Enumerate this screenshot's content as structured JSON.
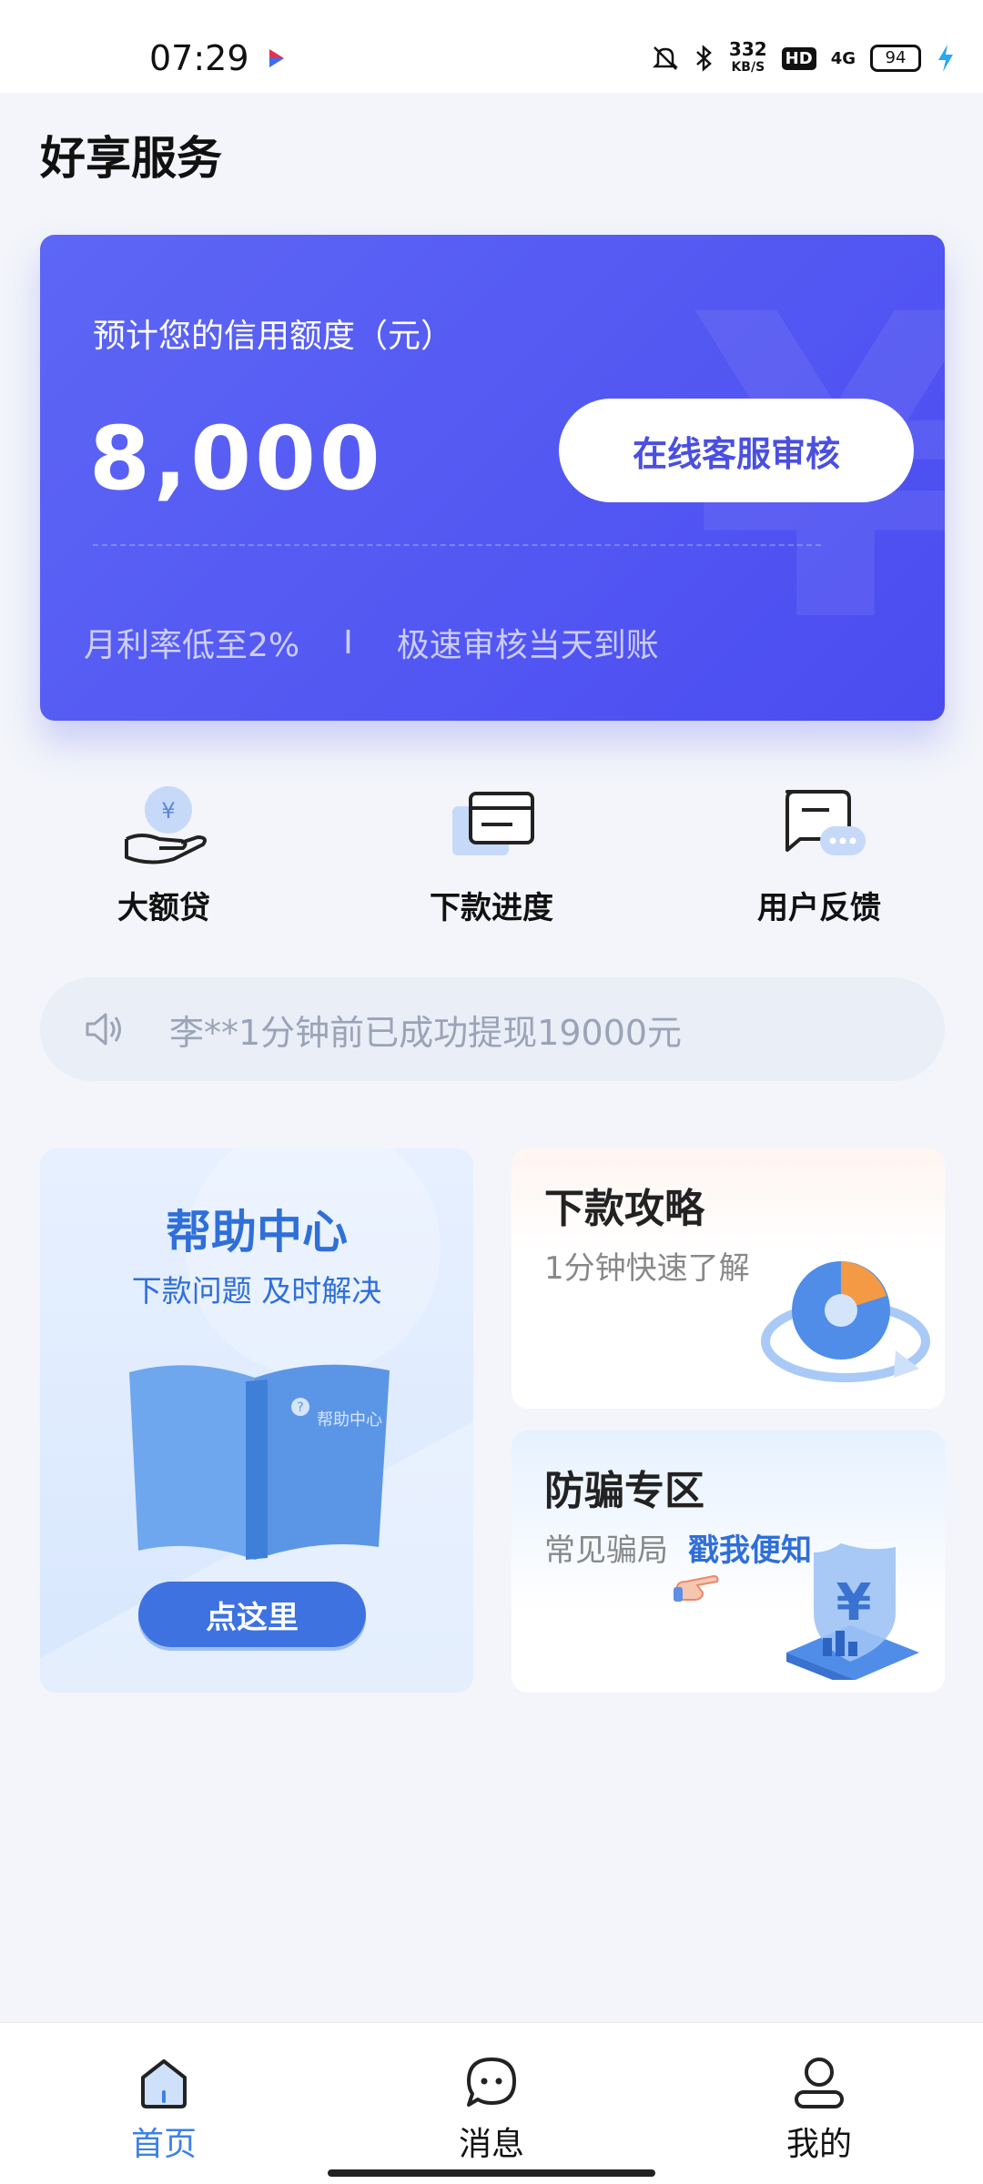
{
  "status_bar": {
    "time": "07:29",
    "speed_value": "332",
    "speed_unit": "KB/S",
    "hd": "HD",
    "network": "4G",
    "battery": "94"
  },
  "page": {
    "title": "好享服务"
  },
  "credit_card": {
    "label": "预计您的信用额度（元）",
    "amount": "8,000",
    "cta": "在线客服审核",
    "feature_1": "月利率低至2%",
    "separator": "I",
    "feature_2": "极速审核当天到账",
    "accent": "#4b4cf0"
  },
  "quick_actions": [
    {
      "label": "大额贷",
      "icon": "hand-yen-icon"
    },
    {
      "label": "下款进度",
      "icon": "card-icon"
    },
    {
      "label": "用户反馈",
      "icon": "chat-bubble-icon"
    }
  ],
  "notice": {
    "text": "李**1分钟前已成功提现19000元",
    "icon": "speaker-icon"
  },
  "help_center": {
    "title": "帮助中心",
    "subtitle": "下款问题 及时解决",
    "book_text": "帮助中心",
    "button": "点这里"
  },
  "guide_card": {
    "title": "下款攻略",
    "subtitle": "1分钟快速了解"
  },
  "fraud_card": {
    "title": "防骗专区",
    "subtitle": "常见骗局",
    "link": "戳我便知"
  },
  "tab_bar": {
    "tabs": [
      {
        "label": "首页",
        "icon": "home-icon",
        "active": true
      },
      {
        "label": "消息",
        "icon": "message-icon",
        "active": false
      },
      {
        "label": "我的",
        "icon": "profile-icon",
        "active": false
      }
    ],
    "active_color": "#3d80e8"
  }
}
